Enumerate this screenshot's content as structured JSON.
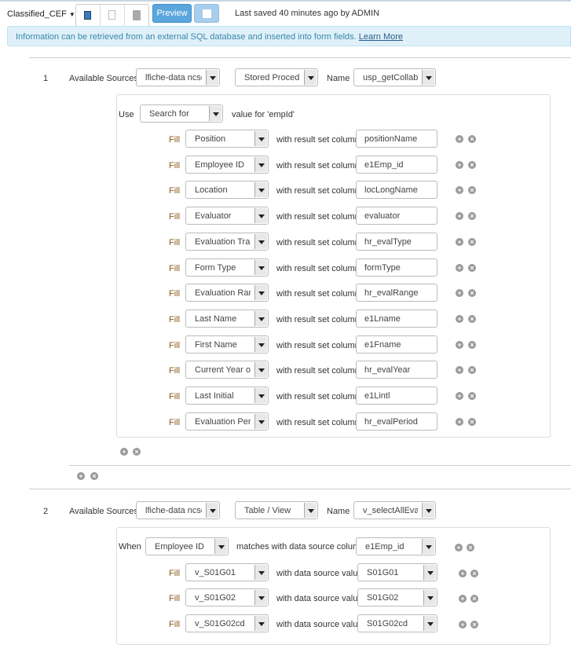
{
  "header": {
    "form_name": "Classified_CEF",
    "preview_label": "Preview",
    "last_saved": "Last saved 40 minutes ago by ADMIN"
  },
  "info": {
    "text": "Information can be retrieved from an external SQL database and inserted into form fields.",
    "link": "Learn More"
  },
  "labels": {
    "available_sources": "Available Sources",
    "name": "Name",
    "use": "Use",
    "fill": "Fill",
    "value_for": "value for 'empId'",
    "with_result": "with result set column",
    "when": "When",
    "matches": "matches with data source column",
    "with_value": "with data source value"
  },
  "section1": {
    "index": "1",
    "source": "lfiche-data ncsd",
    "type": "Stored Procedure",
    "name": "usp_getCollabGr",
    "use": "Search for",
    "rows": [
      {
        "field": "Position",
        "column": "positionName"
      },
      {
        "field": "Employee ID",
        "column": "e1Emp_id"
      },
      {
        "field": "Location",
        "column": "locLongName"
      },
      {
        "field": "Evaluator",
        "column": "evaluator"
      },
      {
        "field": "Evaluation Track",
        "column": "hr_evalType"
      },
      {
        "field": "Form Type",
        "column": "formType"
      },
      {
        "field": "Evaluation Range",
        "column": "hr_evalRange"
      },
      {
        "field": "Last Name",
        "column": "e1Lname"
      },
      {
        "field": "First Name",
        "column": "e1Fname"
      },
      {
        "field": "Current Year on",
        "column": "hr_evalYear"
      },
      {
        "field": "Last Initial",
        "column": "e1Lintl"
      },
      {
        "field": "Evaluation Period",
        "column": "hr_evalPeriod"
      }
    ]
  },
  "section2": {
    "index": "2",
    "source": "lfiche-data ncsd",
    "type": "Table / View",
    "name": "v_selectAllEvalD",
    "when_field": "Employee ID",
    "when_column": "e1Emp_id",
    "rows": [
      {
        "field": "v_S01G01",
        "value": "S01G01"
      },
      {
        "field": "v_S01G02",
        "value": "S01G02"
      },
      {
        "field": "v_S01G02cd",
        "value": "S01G02cd"
      }
    ]
  }
}
